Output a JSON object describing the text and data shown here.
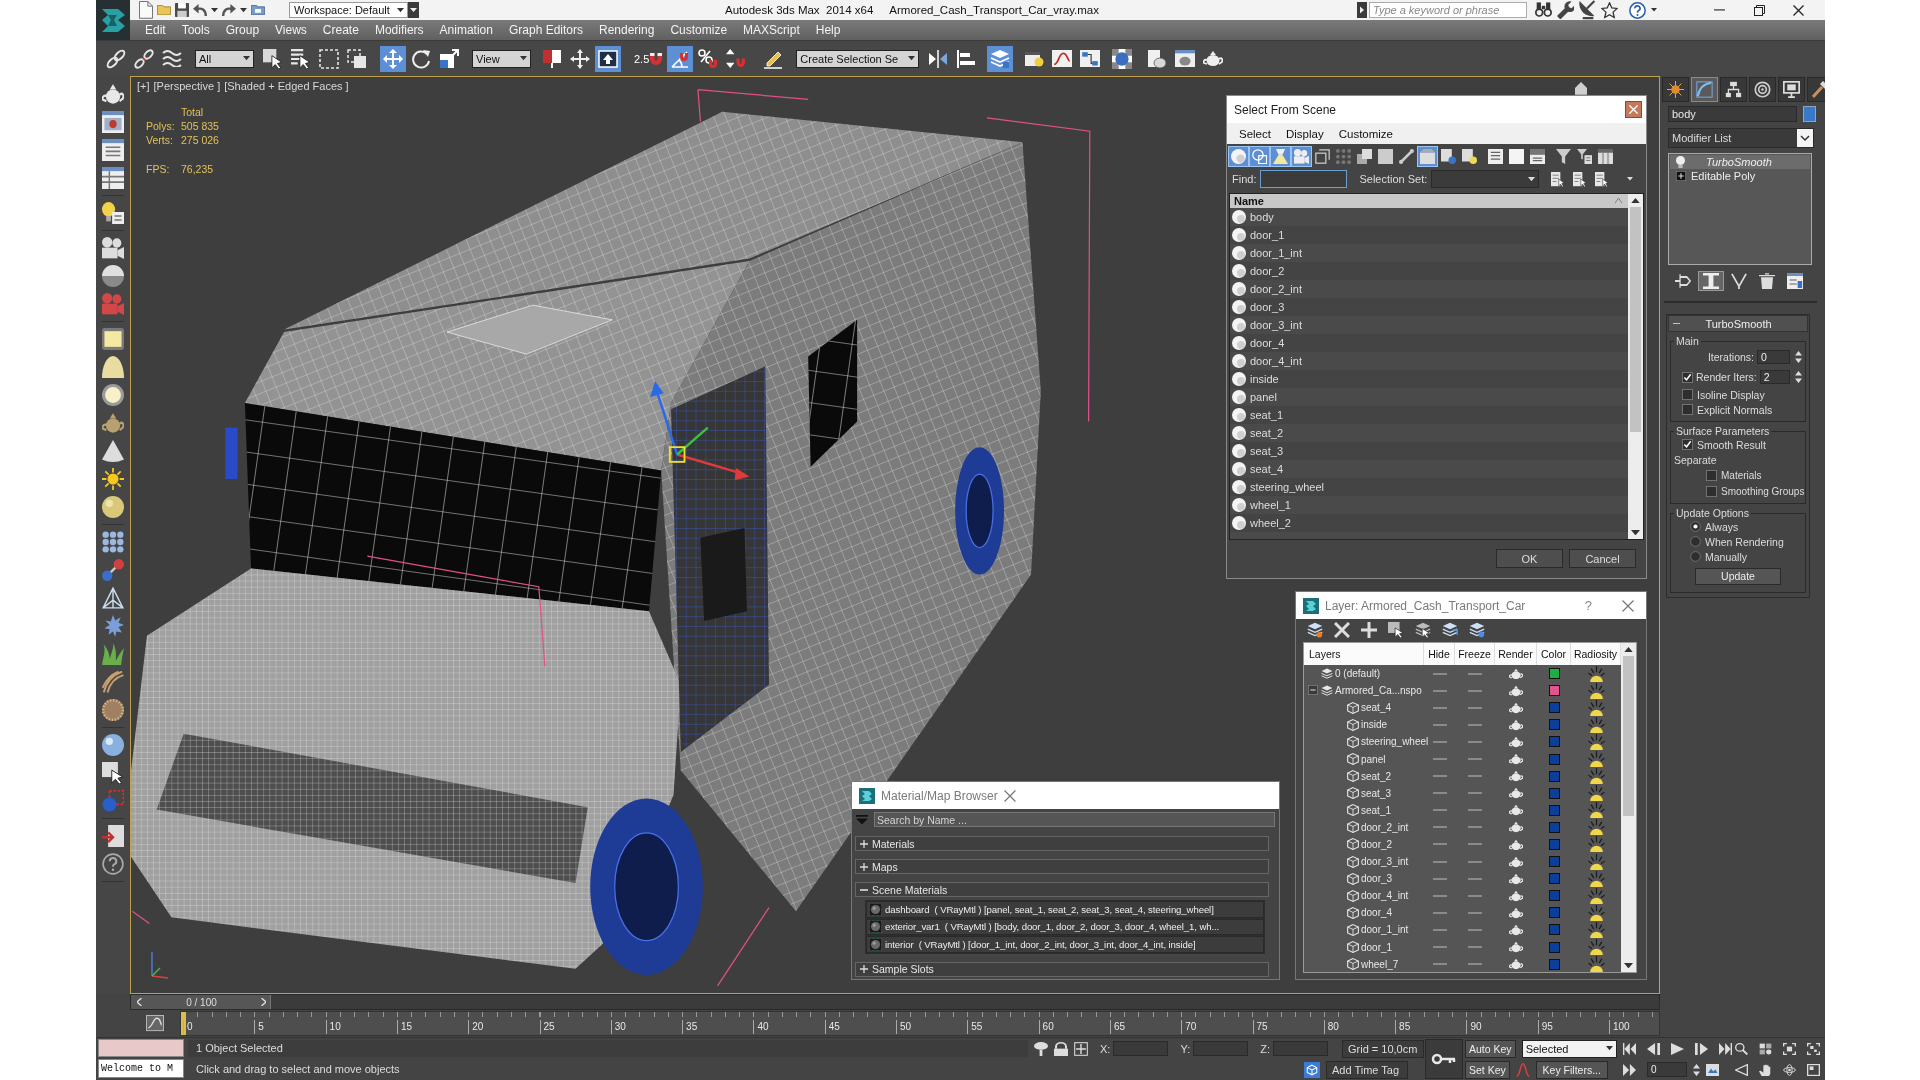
{
  "window": {
    "title": "Autodesk 3ds Max  2014 x64",
    "file": "Armored_Cash_Transport_Car_vray.max",
    "workspace": "Workspace: Default",
    "search": {
      "placeholder": "Type a keyword or phrase"
    }
  },
  "menu": [
    "Edit",
    "Tools",
    "Group",
    "Views",
    "Create",
    "Modifiers",
    "Animation",
    "Graph Editors",
    "Rendering",
    "Customize",
    "MAXScript",
    "Help"
  ],
  "main_toolbar": [
    {
      "kind": "link",
      "selected": false
    },
    {
      "kind": "unlink",
      "selected": false
    },
    {
      "kind": "bind",
      "selected": false
    },
    {
      "kind": "dropdown",
      "value": "All"
    },
    {
      "kind": "select",
      "selected": false
    },
    {
      "kind": "select_by_name",
      "selected": false
    },
    {
      "kind": "region",
      "selected": false
    },
    {
      "kind": "crossing",
      "selected": false
    },
    {
      "kind": "move",
      "selected": true
    },
    {
      "kind": "rotate",
      "selected": false
    },
    {
      "kind": "scale",
      "selected": false
    },
    {
      "kind": "dropdown",
      "value": "View"
    },
    {
      "kind": "pivot",
      "selected": false
    },
    {
      "kind": "manipulate",
      "selected": false
    },
    {
      "kind": "shortcut",
      "selected": true
    },
    {
      "kind": "snap",
      "label": "2.5",
      "selected": false
    },
    {
      "kind": "angle_snap",
      "selected": true
    },
    {
      "kind": "percent_snap",
      "selected": false
    },
    {
      "kind": "spinner_snap",
      "selected": false
    },
    {
      "kind": "named_sets",
      "selected": false
    },
    {
      "kind": "dropdown",
      "value": "Create Selection Se"
    },
    {
      "kind": "mirror",
      "selected": false
    },
    {
      "kind": "align",
      "selected": false
    },
    {
      "kind": "layers",
      "selected": true
    },
    {
      "kind": "ribbon",
      "selected": false
    },
    {
      "kind": "curve_editor",
      "selected": false
    },
    {
      "kind": "schematic",
      "selected": false
    },
    {
      "kind": "material_editor",
      "selected": false
    },
    {
      "kind": "render_setup",
      "selected": false
    },
    {
      "kind": "frame_window",
      "selected": false
    },
    {
      "kind": "render",
      "selected": false
    }
  ],
  "viewport": {
    "labels": [
      "[+]",
      "[Perspective ]",
      "[Shaded + Edged Faces ]"
    ],
    "stats": {
      "heading": "Total",
      "rows": [
        {
          "label": "Polys:",
          "value": "505 835"
        },
        {
          "label": "Verts:",
          "value": "275 026"
        }
      ],
      "fps": {
        "label": "FPS:",
        "value": "76,235"
      }
    }
  },
  "select_from_scene": {
    "title": "Select From Scene",
    "menu": [
      "Select",
      "Display",
      "Customize"
    ],
    "tools": [
      {
        "kind": "geometry",
        "selected": true
      },
      {
        "kind": "shapes",
        "selected": true
      },
      {
        "kind": "lights",
        "selected": true
      },
      {
        "kind": "cameras",
        "selected": true
      },
      {
        "kind": "helpers",
        "selected": false
      },
      {
        "kind": "space_warps",
        "selected": false
      },
      {
        "kind": "groups",
        "selected": false
      },
      {
        "kind": "xrefs",
        "selected": false
      },
      {
        "kind": "bones",
        "selected": false
      },
      {
        "kind": "containers",
        "selected": true
      },
      {
        "kind": "frozen",
        "selected": false
      },
      {
        "kind": "hidden",
        "selected": false
      },
      {
        "kind": "all",
        "selected": false
      },
      {
        "kind": "none",
        "selected": false
      },
      {
        "kind": "invert",
        "selected": false
      },
      {
        "kind": "filter",
        "selected": false
      },
      {
        "kind": "filter_selected",
        "selected": false
      },
      {
        "kind": "columns",
        "selected": false
      }
    ],
    "find_label": "Find:",
    "selection_set_label": "Selection Set:",
    "column": "Name",
    "objects": [
      {
        "name": "body",
        "selected": false
      },
      {
        "name": "door_1",
        "selected": false
      },
      {
        "name": "door_1_int",
        "selected": false
      },
      {
        "name": "door_2",
        "selected": false
      },
      {
        "name": "door_2_int",
        "selected": false
      },
      {
        "name": "door_3",
        "selected": false
      },
      {
        "name": "door_3_int",
        "selected": false
      },
      {
        "name": "door_4",
        "selected": false
      },
      {
        "name": "door_4_int",
        "selected": false
      },
      {
        "name": "inside",
        "selected": false
      },
      {
        "name": "panel",
        "selected": false
      },
      {
        "name": "seat_1",
        "selected": false
      },
      {
        "name": "seat_2",
        "selected": false
      },
      {
        "name": "seat_3",
        "selected": false
      },
      {
        "name": "seat_4",
        "selected": false
      },
      {
        "name": "steering_wheel",
        "selected": false
      },
      {
        "name": "wheel_1",
        "selected": false
      },
      {
        "name": "wheel_2",
        "selected": false
      }
    ],
    "buttons": [
      "OK",
      "Cancel"
    ]
  },
  "layer_manager": {
    "title": "Layer: Armored_Cash_Transport_Car",
    "help": "?",
    "columns": [
      "Layers",
      "Hide",
      "Freeze",
      "Render",
      "Color",
      "Radiosity"
    ],
    "layers": [
      {
        "name": "0 (default)",
        "kind": "layer",
        "color": "#1fae45"
      },
      {
        "name": "Armored_Ca...nspo",
        "kind": "layer",
        "color": "#e2538f",
        "expanded": true,
        "children": [
          {
            "name": "seat_4",
            "kind": "object",
            "color": "#0c3f9a"
          },
          {
            "name": "inside",
            "kind": "object",
            "color": "#0c3f9a"
          },
          {
            "name": "steering_wheel",
            "kind": "object",
            "color": "#0c3f9a"
          },
          {
            "name": "panel",
            "kind": "object",
            "color": "#0c3f9a"
          },
          {
            "name": "seat_2",
            "kind": "object",
            "color": "#0c3f9a"
          },
          {
            "name": "seat_3",
            "kind": "object",
            "color": "#0c3f9a"
          },
          {
            "name": "seat_1",
            "kind": "object",
            "color": "#0c3f9a"
          },
          {
            "name": "door_2_int",
            "kind": "object",
            "color": "#0c3f9a"
          },
          {
            "name": "door_2",
            "kind": "object",
            "color": "#0c3f9a"
          },
          {
            "name": "door_3_int",
            "kind": "object",
            "color": "#0c3f9a"
          },
          {
            "name": "door_3",
            "kind": "object",
            "color": "#0c3f9a"
          },
          {
            "name": "door_4_int",
            "kind": "object",
            "color": "#0c3f9a"
          },
          {
            "name": "door_4",
            "kind": "object",
            "color": "#0c3f9a"
          },
          {
            "name": "door_1_int",
            "kind": "object",
            "color": "#0c3f9a"
          },
          {
            "name": "door_1",
            "kind": "object",
            "color": "#0c3f9a"
          },
          {
            "name": "wheel_7",
            "kind": "object",
            "color": "#0c3f9a"
          }
        ]
      }
    ]
  },
  "material_browser": {
    "title": "Material/Map Browser",
    "search": {
      "placeholder": "Search by Name ..."
    },
    "groups": [
      {
        "label": "Materials",
        "expanded": false
      },
      {
        "label": "Maps",
        "expanded": false
      },
      {
        "label": "Scene Materials",
        "expanded": true,
        "items": [
          "dashboard  ( VRayMtl ) [panel, seat_1, seat_2, seat_3, seat_4, steering_wheel]",
          "exterior_var1  ( VRayMtl ) [body, door_1, door_2, door_3, door_4, wheel_1, wh...",
          "interior  ( VRayMtl ) [door_1_int, door_2_int, door_3_int, door_4_int, inside]"
        ]
      },
      {
        "label": "Sample Slots",
        "expanded": false
      }
    ]
  },
  "command_panel": {
    "tabs": [
      {
        "kind": "create",
        "selected": false
      },
      {
        "kind": "modify",
        "selected": true
      },
      {
        "kind": "hierarchy",
        "selected": false
      },
      {
        "kind": "motion",
        "selected": false
      },
      {
        "kind": "display",
        "selected": false
      },
      {
        "kind": "utilities",
        "selected": false
      }
    ],
    "object_name": "body",
    "modifier_list": "Modifier List",
    "stack": [
      {
        "name": "TurboSmooth",
        "kind": "modifier",
        "selected": true
      },
      {
        "name": "Editable Poly",
        "kind": "base_object",
        "selected": false
      }
    ],
    "stack_tools": [
      {
        "kind": "pin",
        "selected": false
      },
      {
        "kind": "end_result",
        "selected": true
      },
      {
        "kind": "make_unique",
        "selected": false
      },
      {
        "kind": "remove",
        "selected": false
      },
      {
        "kind": "configure",
        "selected": false
      }
    ],
    "rollout": {
      "title": "TurboSmooth",
      "expanded": true,
      "groups": [
        {
          "title": "Main",
          "controls": [
            {
              "kind": "spinner",
              "label": "Iterations:",
              "value": "0"
            },
            {
              "kind": "checked_spinner",
              "label": "Render Iters:",
              "checked": true,
              "value": "2"
            },
            {
              "kind": "checkbox",
              "label": "Isoline Display",
              "checked": false
            },
            {
              "kind": "checkbox",
              "label": "Explicit Normals",
              "checked": false
            }
          ]
        },
        {
          "title": "Surface Parameters",
          "controls": [
            {
              "kind": "checkbox",
              "label": "Smooth Result",
              "checked": true
            },
            {
              "kind": "label",
              "label": "Separate"
            },
            {
              "kind": "sub_checkbox",
              "label": "Materials",
              "checked": false
            },
            {
              "kind": "sub_checkbox",
              "label": "Smoothing Groups",
              "checked": false
            }
          ]
        },
        {
          "title": "Update Options",
          "controls": [
            {
              "kind": "radio",
              "label": "Always",
              "selected": true
            },
            {
              "kind": "radio",
              "label": "When Rendering",
              "selected": false
            },
            {
              "kind": "radio",
              "label": "Manually",
              "selected": false
            },
            {
              "kind": "button",
              "label": "Update"
            }
          ]
        }
      ]
    }
  },
  "timeline": {
    "slider": {
      "label": "0 / 100",
      "level": 0
    },
    "ticks": [
      "0",
      "5",
      "10",
      "15",
      "20",
      "25",
      "30",
      "35",
      "40",
      "45",
      "50",
      "55",
      "60",
      "65",
      "70",
      "75",
      "80",
      "85",
      "90",
      "95",
      "100"
    ]
  },
  "status_bar": {
    "listener": "Welcome to M",
    "selection": "1 Object Selected",
    "prompt": "Click and drag to select and move objects",
    "coords": [
      "X:",
      "Y:",
      "Z:"
    ],
    "grid": "Grid = 10,0cm",
    "time_tag": "Add Time Tag",
    "auto_key": "Auto Key",
    "set_key": "Set Key",
    "key_mode": "Selected",
    "key_filters": "Key Filters...",
    "frame": "0"
  }
}
